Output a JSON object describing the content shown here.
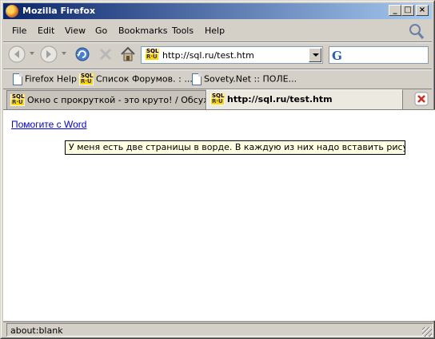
{
  "window": {
    "title": "Mozilla Firefox"
  },
  "title_buttons": {
    "minimize": "_",
    "maximize": "□",
    "close": "×"
  },
  "menu": [
    {
      "label": "File"
    },
    {
      "label": "Edit"
    },
    {
      "label": "View"
    },
    {
      "label": "Go"
    },
    {
      "label": "Bookmarks"
    },
    {
      "label": "Tools"
    },
    {
      "label": "Help"
    }
  ],
  "navigation": {
    "url": "http://sql.ru/test.htm",
    "search_engine_icon": "google-g-icon",
    "search_logo": "G"
  },
  "bookmarks": [
    {
      "label": "Firefox Help",
      "icon": "page-icon"
    },
    {
      "label": "Список Форумов. : ...",
      "icon": "sql-ru-icon"
    },
    {
      "label": "Sovety.Net :: ПОЛЕ...",
      "icon": "page-icon"
    }
  ],
  "tabs": [
    {
      "label": "Окно с прокруткой - это круто! / Обсуж...",
      "active": false
    },
    {
      "label": "http://sql.ru/test.htm",
      "active": true
    }
  ],
  "favicon_text": {
    "top": "SQL",
    "bottom": "R·U"
  },
  "page": {
    "link_text": "Помогите с Word",
    "tooltip": "У меня есть две страницы в ворде. В каждую из них надо вставить рисунок. ..."
  },
  "status": {
    "text": "about:blank"
  },
  "colors": {
    "titlebar_start": "#0a246a",
    "titlebar_end": "#a6caf0",
    "link": "#0000ee",
    "tooltip_bg": "#ffffe1"
  }
}
